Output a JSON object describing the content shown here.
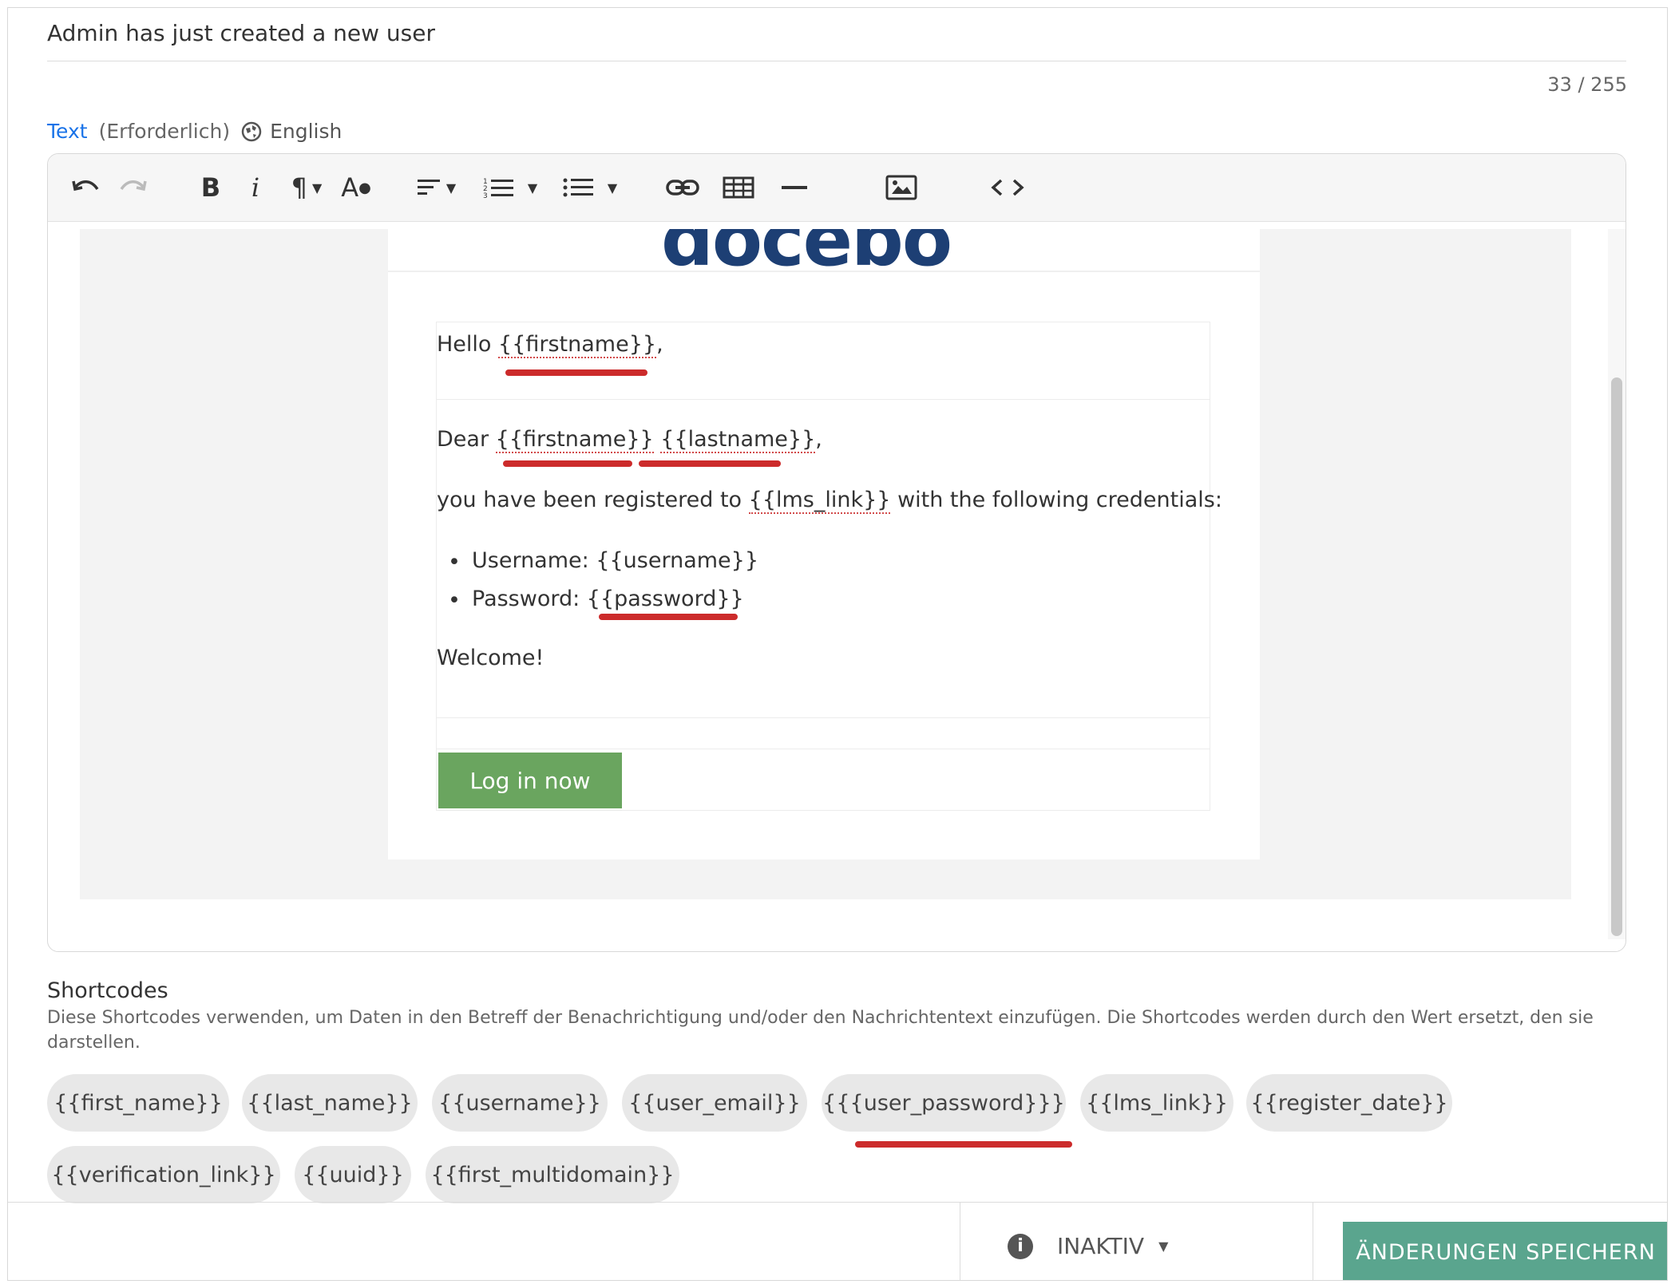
{
  "subject": {
    "value": "Admin has just created a new user",
    "counter": "33 / 255"
  },
  "text_field": {
    "label": "Text",
    "required": "(Erforderlich)",
    "language": "English"
  },
  "toolbar": {
    "icons": [
      "undo-icon",
      "redo-icon",
      "bold-icon",
      "italic-icon",
      "paragraph-icon",
      "text-color-icon",
      "align-icon",
      "ordered-list-icon",
      "unordered-list-icon",
      "link-icon",
      "table-icon",
      "horizontal-rule-icon",
      "image-icon",
      "code-view-icon"
    ]
  },
  "email": {
    "logo": "docebo",
    "greeting_prefix": "Hello ",
    "greeting_code": "{{firstname}}",
    "greeting_suffix": ",",
    "dear_prefix": "Dear ",
    "dear_code1": "{{firstname}}",
    "dear_code2": "{{lastname}}",
    "dear_suffix": ",",
    "registered_prefix": "you have been registered to ",
    "registered_code": "{{lms_link}}",
    "registered_suffix": " with the following credentials:",
    "username_line": "Username: {{username}}",
    "password_prefix": "Password: ",
    "password_code": "{{password}}",
    "welcome": "Welcome!",
    "button": "Log in now"
  },
  "shortcodes": {
    "title": "Shortcodes",
    "description": "Diese Shortcodes verwenden, um Daten in den Betreff der Benachrichtigung und/oder den Nachrichtentext einzufügen. Die Shortcodes werden durch den Wert ersetzt, den sie darstellen.",
    "chips": [
      "{{first_name}}",
      "{{last_name}}",
      "{{username}}",
      "{{user_email}}",
      "{{{user_password}}}",
      "{{lms_link}}",
      "{{register_date}}",
      "{{verification_link}}",
      "{{uuid}}",
      "{{first_multidomain}}"
    ]
  },
  "footer": {
    "status": "INAKTIV",
    "save_button": "ÄNDERUNGEN SPEICHERN"
  },
  "colors": {
    "annotation": "#cc2b2b",
    "accent": "#1a73e8",
    "save": "#5aa58e",
    "login": "#6aa55f"
  }
}
